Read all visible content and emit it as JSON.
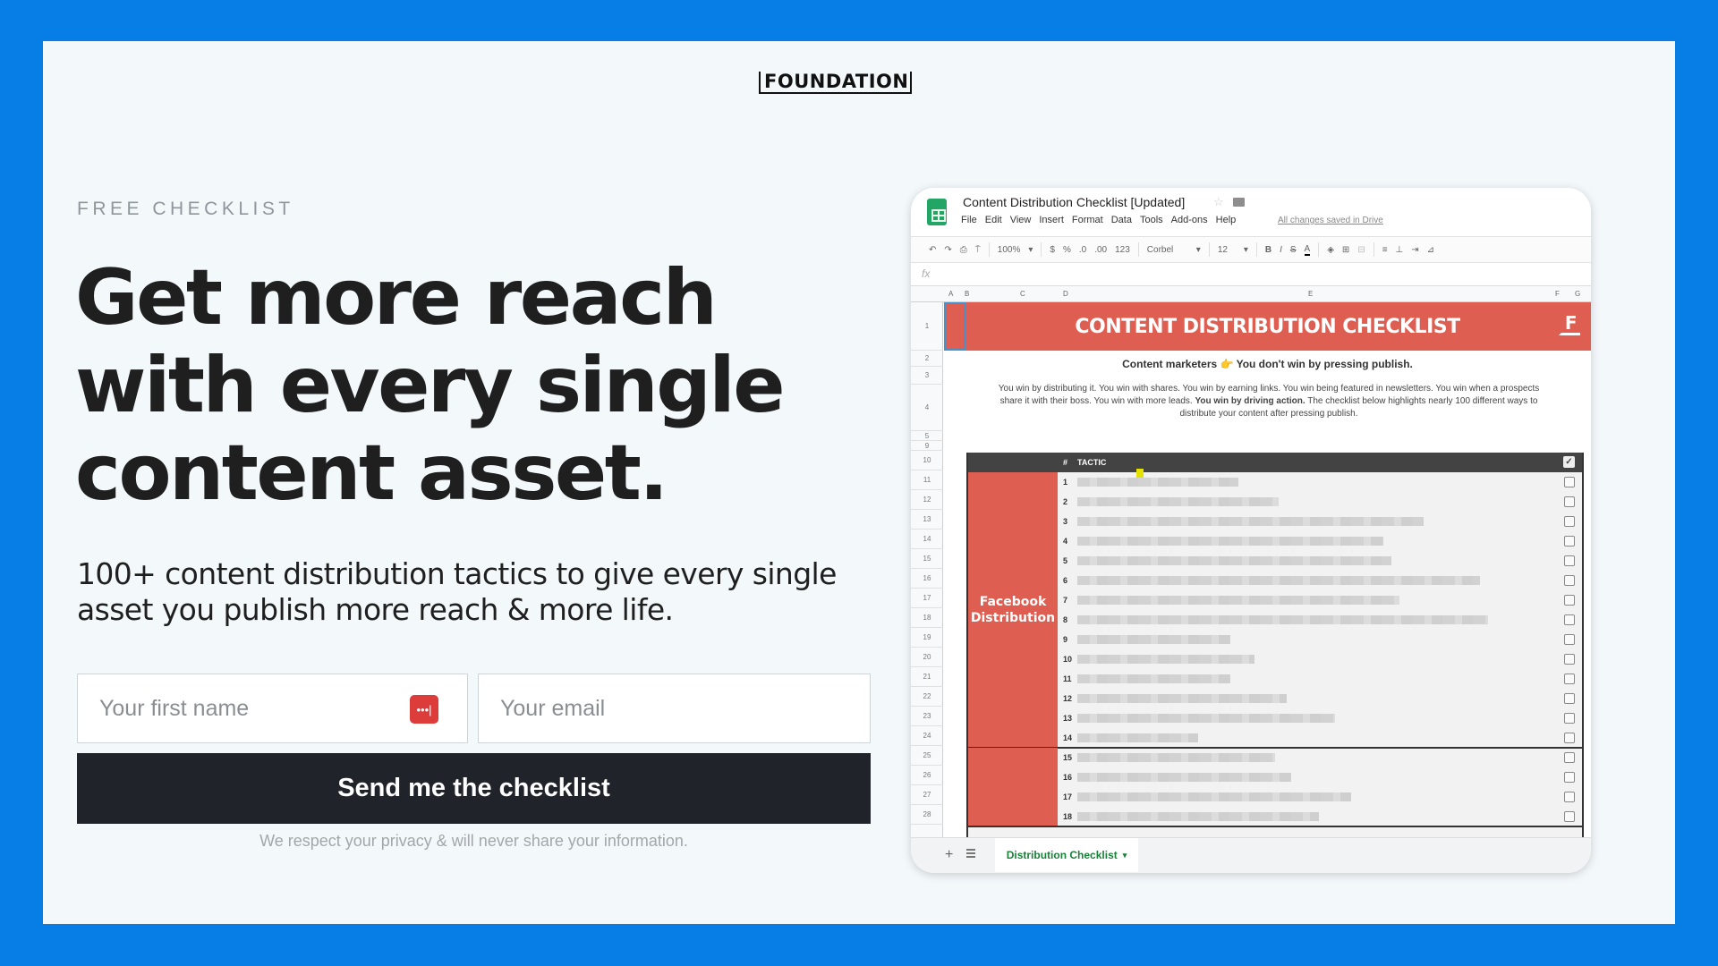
{
  "brand": {
    "logo": "FOUNDATION"
  },
  "hero": {
    "eyebrow": "FREE CHECKLIST",
    "headline": [
      "Get more reach",
      "with every single",
      "content asset."
    ],
    "subheading": "100+ content distribution tactics to give every single asset you publish more reach & more life."
  },
  "form": {
    "first_name_placeholder": "Your first name",
    "email_placeholder": "Your email",
    "password_manager_icon": "•••|",
    "submit_label": "Send me the checklist",
    "privacy_note": "We respect your privacy & will never share your information."
  },
  "spreadsheet": {
    "doc_title": "Content Distribution Checklist [Updated]",
    "menu": [
      "File",
      "Edit",
      "View",
      "Insert",
      "Format",
      "Data",
      "Tools",
      "Add-ons",
      "Help"
    ],
    "save_status": "All changes saved in Drive",
    "toolbar": {
      "undo": "↶",
      "redo": "↷",
      "print": "⎙",
      "paint_format": "⍑",
      "zoom": "100%",
      "currency": "$",
      "percent": "%",
      "dec_less": ".0",
      "dec_more": ".00",
      "number_format": "123",
      "font": "Corbel",
      "font_size": "12",
      "bold": "B",
      "italic": "I",
      "strike": "S",
      "text_color": "A",
      "fill": "◈",
      "borders": "⊞",
      "merge": "⊟",
      "align": "≡",
      "valign": "⊥",
      "wrap": "⇥",
      "rotate": "⊿"
    },
    "fx_label": "fx",
    "columns": [
      "A",
      "B",
      "C",
      "D",
      "E",
      "F",
      "G"
    ],
    "row_numbers": [
      "1",
      "2",
      "3",
      "4",
      "5",
      "9",
      "10",
      "11",
      "12",
      "13",
      "14",
      "15",
      "16",
      "17",
      "18",
      "19",
      "20",
      "21",
      "22",
      "23",
      "24",
      "25",
      "26",
      "27",
      "28"
    ],
    "sheet_title": "CONTENT DISTRIBUTION CHECKLIST",
    "sheet_logo": "F",
    "tagline_prefix": "Content marketers",
    "tagline_emoji": "👉",
    "tagline_suffix": "You don't win by pressing publish.",
    "intro_text": "You win by distributing it. You win with shares. You win by earning links. You win being featured in newsletters. You win when a prospects share it with their boss. You win with more leads.",
    "intro_bold": "You win by driving action.",
    "intro_tail": "The checklist below highlights nearly 100 different ways to distribute your content after pressing publish.",
    "table": {
      "col_hash": "#",
      "col_tactic": "TACTIC",
      "header_check": "✓",
      "categories": [
        {
          "name": "Facebook Distribution",
          "rows": [
            "1",
            "2",
            "3",
            "4",
            "5",
            "6",
            "7",
            "8",
            "9",
            "10",
            "11",
            "12",
            "13",
            "14"
          ]
        },
        {
          "name": "",
          "rows": [
            "15",
            "16",
            "17",
            "18"
          ]
        }
      ],
      "tactic_text_redacted": true,
      "row_checked": [
        false,
        false,
        false,
        false,
        false,
        false,
        false,
        false,
        false,
        false,
        false,
        false,
        false,
        false,
        false,
        false,
        false,
        false
      ]
    },
    "sheet_tab": "Distribution Checklist",
    "add_sheet": "+",
    "colors": {
      "header_red": "#df5e52",
      "table_header": "#434343",
      "sheet_tab_green": "#188038"
    }
  },
  "colors": {
    "frame_blue": "#077de6",
    "panel_bg": "#f3f8fb",
    "button_dark": "#20232a",
    "text_dark": "#1f1f1f"
  }
}
